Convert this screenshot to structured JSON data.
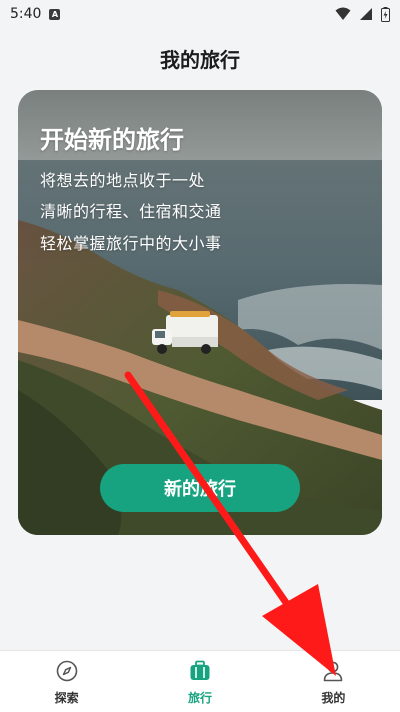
{
  "status_bar": {
    "time": "5:40",
    "notification_badge": "A"
  },
  "header": {
    "title": "我的旅行"
  },
  "hero": {
    "title": "开始新的旅行",
    "lines": [
      "将想去的地点收于一处",
      "清晰的行程、住宿和交通",
      "轻松掌握旅行中的大小事"
    ],
    "button_label": "新的旅行"
  },
  "bottom_nav": {
    "items": [
      {
        "label": "探索",
        "icon": "compass-icon",
        "active": false
      },
      {
        "label": "旅行",
        "icon": "suitcase-icon",
        "active": true
      },
      {
        "label": "我的",
        "icon": "user-icon",
        "active": false
      }
    ]
  },
  "colors": {
    "accent": "#17a37f",
    "background": "#f3f4f6",
    "annotation": "#ff1a1a"
  }
}
